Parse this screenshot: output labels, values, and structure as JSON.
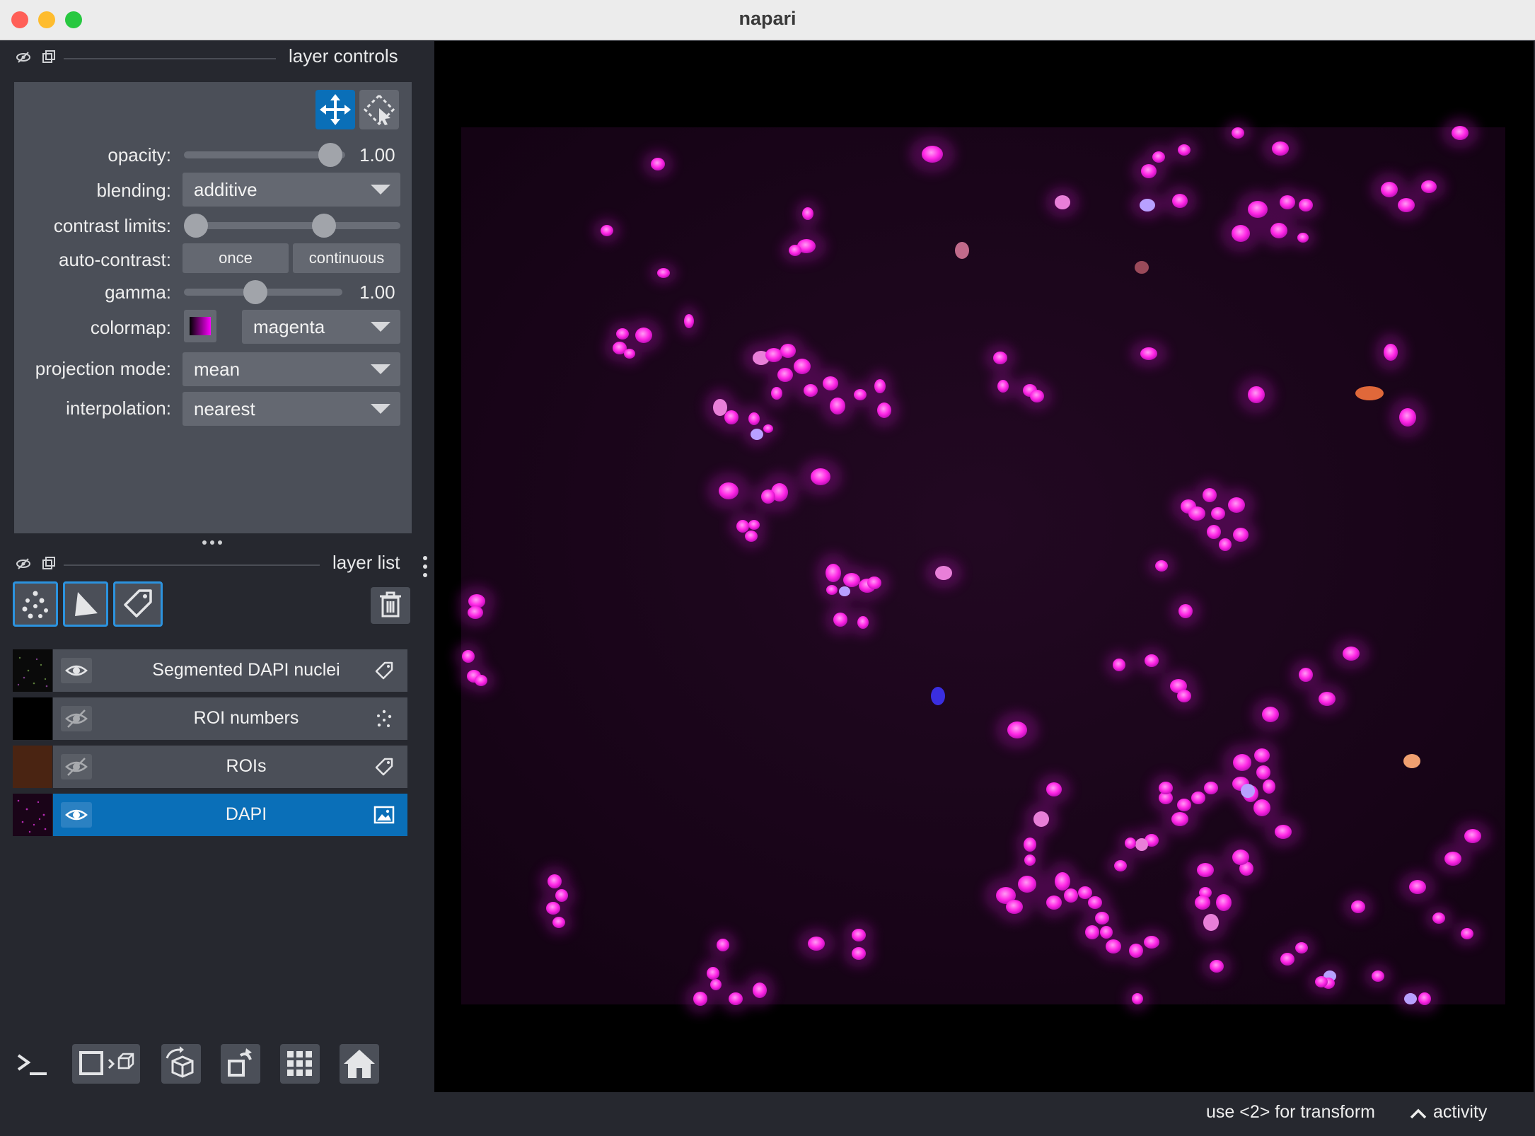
{
  "window": {
    "title": "napari",
    "colors": {
      "close": "#ff5f57",
      "minimize": "#febc2e",
      "maximize": "#28c840"
    }
  },
  "layer_controls": {
    "header": "layer controls",
    "opacity": {
      "label": "opacity:",
      "value_text": "1.00",
      "value": 1.0
    },
    "blending": {
      "label": "blending:",
      "value": "additive"
    },
    "contrast_limits": {
      "label": "contrast limits:",
      "low": 0.0,
      "high": 0.6
    },
    "auto_contrast": {
      "label": "auto-contrast:",
      "once": "once",
      "continuous": "continuous"
    },
    "gamma": {
      "label": "gamma:",
      "value_text": "1.00",
      "value": 0.5
    },
    "colormap": {
      "label": "colormap:",
      "value": "magenta"
    },
    "projection_mode": {
      "label": "projection mode:",
      "value": "mean"
    },
    "interpolation": {
      "label": "interpolation:",
      "value": "nearest"
    }
  },
  "layer_list": {
    "header": "layer list",
    "layers": [
      {
        "name": "Segmented DAPI nuclei",
        "visible": true,
        "type_icon": "labels-icon",
        "selected": false
      },
      {
        "name": "ROI numbers",
        "visible": false,
        "type_icon": "points-icon",
        "selected": false
      },
      {
        "name": "ROIs",
        "visible": false,
        "type_icon": "labels-icon",
        "selected": false
      },
      {
        "name": "DAPI",
        "visible": true,
        "type_icon": "image-icon",
        "selected": true
      }
    ]
  },
  "bottom_toolbar": [
    "console-icon",
    "ndisplay-toggle-icon",
    "roll-dims-icon",
    "transpose-icon",
    "grid-icon",
    "home-icon"
  ],
  "status": {
    "message": "use <2> for transform",
    "activity": "activity"
  },
  "accent": "#0a6fb8"
}
